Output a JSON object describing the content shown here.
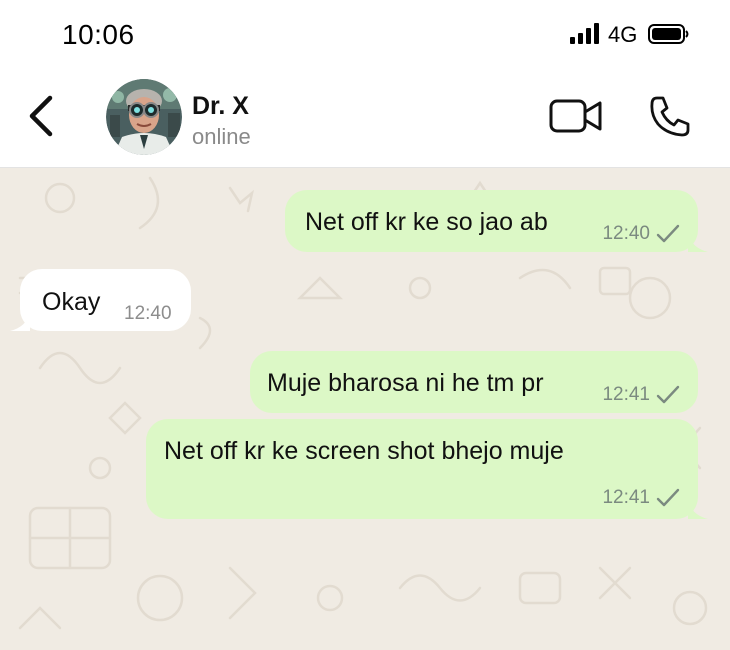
{
  "status_bar": {
    "time": "10:06",
    "network": "4G"
  },
  "header": {
    "contact_name": "Dr. X",
    "contact_status": "online"
  },
  "messages": [
    {
      "direction": "outgoing",
      "text": "Net off kr ke so jao ab",
      "time": "12:40",
      "status": "sent"
    },
    {
      "direction": "incoming",
      "text": "Okay",
      "time": "12:40"
    },
    {
      "direction": "outgoing",
      "text": "Muje bharosa ni he tm pr",
      "time": "12:41",
      "status": "sent"
    },
    {
      "direction": "outgoing",
      "text": "Net off kr ke screen shot bhejo muje",
      "time": "12:41",
      "status": "sent"
    }
  ],
  "colors": {
    "outgoing_bubble": "#dcf8c6",
    "incoming_bubble": "#ffffff",
    "chat_background": "#f0ebe3"
  },
  "icons": [
    "back-chevron-icon",
    "video-camera-icon",
    "phone-icon",
    "signal-icon",
    "battery-icon",
    "checkmark-icon"
  ]
}
